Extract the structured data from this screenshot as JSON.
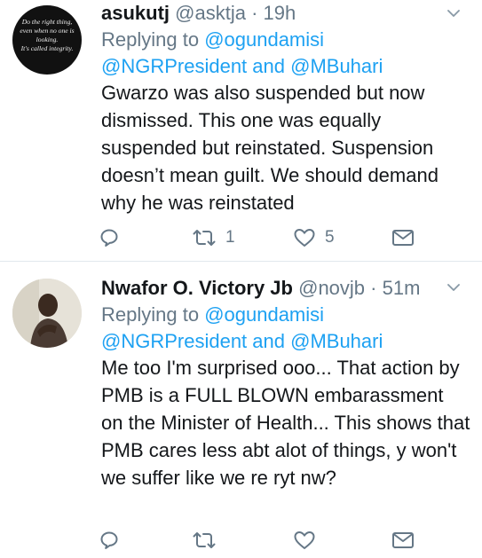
{
  "tweets": [
    {
      "name": "asukutj",
      "handle": "@asktja",
      "dot": " · ",
      "time": "19h",
      "avatar_text": [
        "Do the right thing,",
        "even when no one is",
        "looking.",
        "It's called integrity."
      ],
      "replying_label": "Replying to ",
      "replying_to": "@ogundamisi",
      "mention_1": "@NGRPresident",
      "mention_joiner": " and ",
      "mention_2": "@MBuhari",
      "text": "Gwarzo was also suspended but now dismissed. This one was equally suspended but reinstated. Suspension doesn’t mean guilt. We should demand why he was reinstated",
      "retweets": "1",
      "likes": "5"
    },
    {
      "name": "Nwafor O. Victory Jb",
      "handle": "@novjb",
      "dot": " · ",
      "time": "51m",
      "replying_label": "Replying to ",
      "replying_to": "@ogundamisi",
      "mention_1": "@NGRPresident",
      "mention_joiner": " and ",
      "mention_2": "@MBuhari",
      "text": "Me too I'm surprised ooo... That action by PMB is a FULL BLOWN embarassment on the Minister of Health... This shows that PMB cares less abt alot of things, y won't we suffer like we re ryt nw?",
      "retweets": "",
      "likes": ""
    }
  ],
  "icons": {
    "reply": "reply-icon",
    "retweet": "retweet-icon",
    "like": "heart-icon",
    "dm": "envelope-icon",
    "more": "chevron-down-icon"
  },
  "colors": {
    "link": "#1da1f2",
    "muted": "#657786",
    "text": "#14171a",
    "divider": "#e1e8ed"
  }
}
